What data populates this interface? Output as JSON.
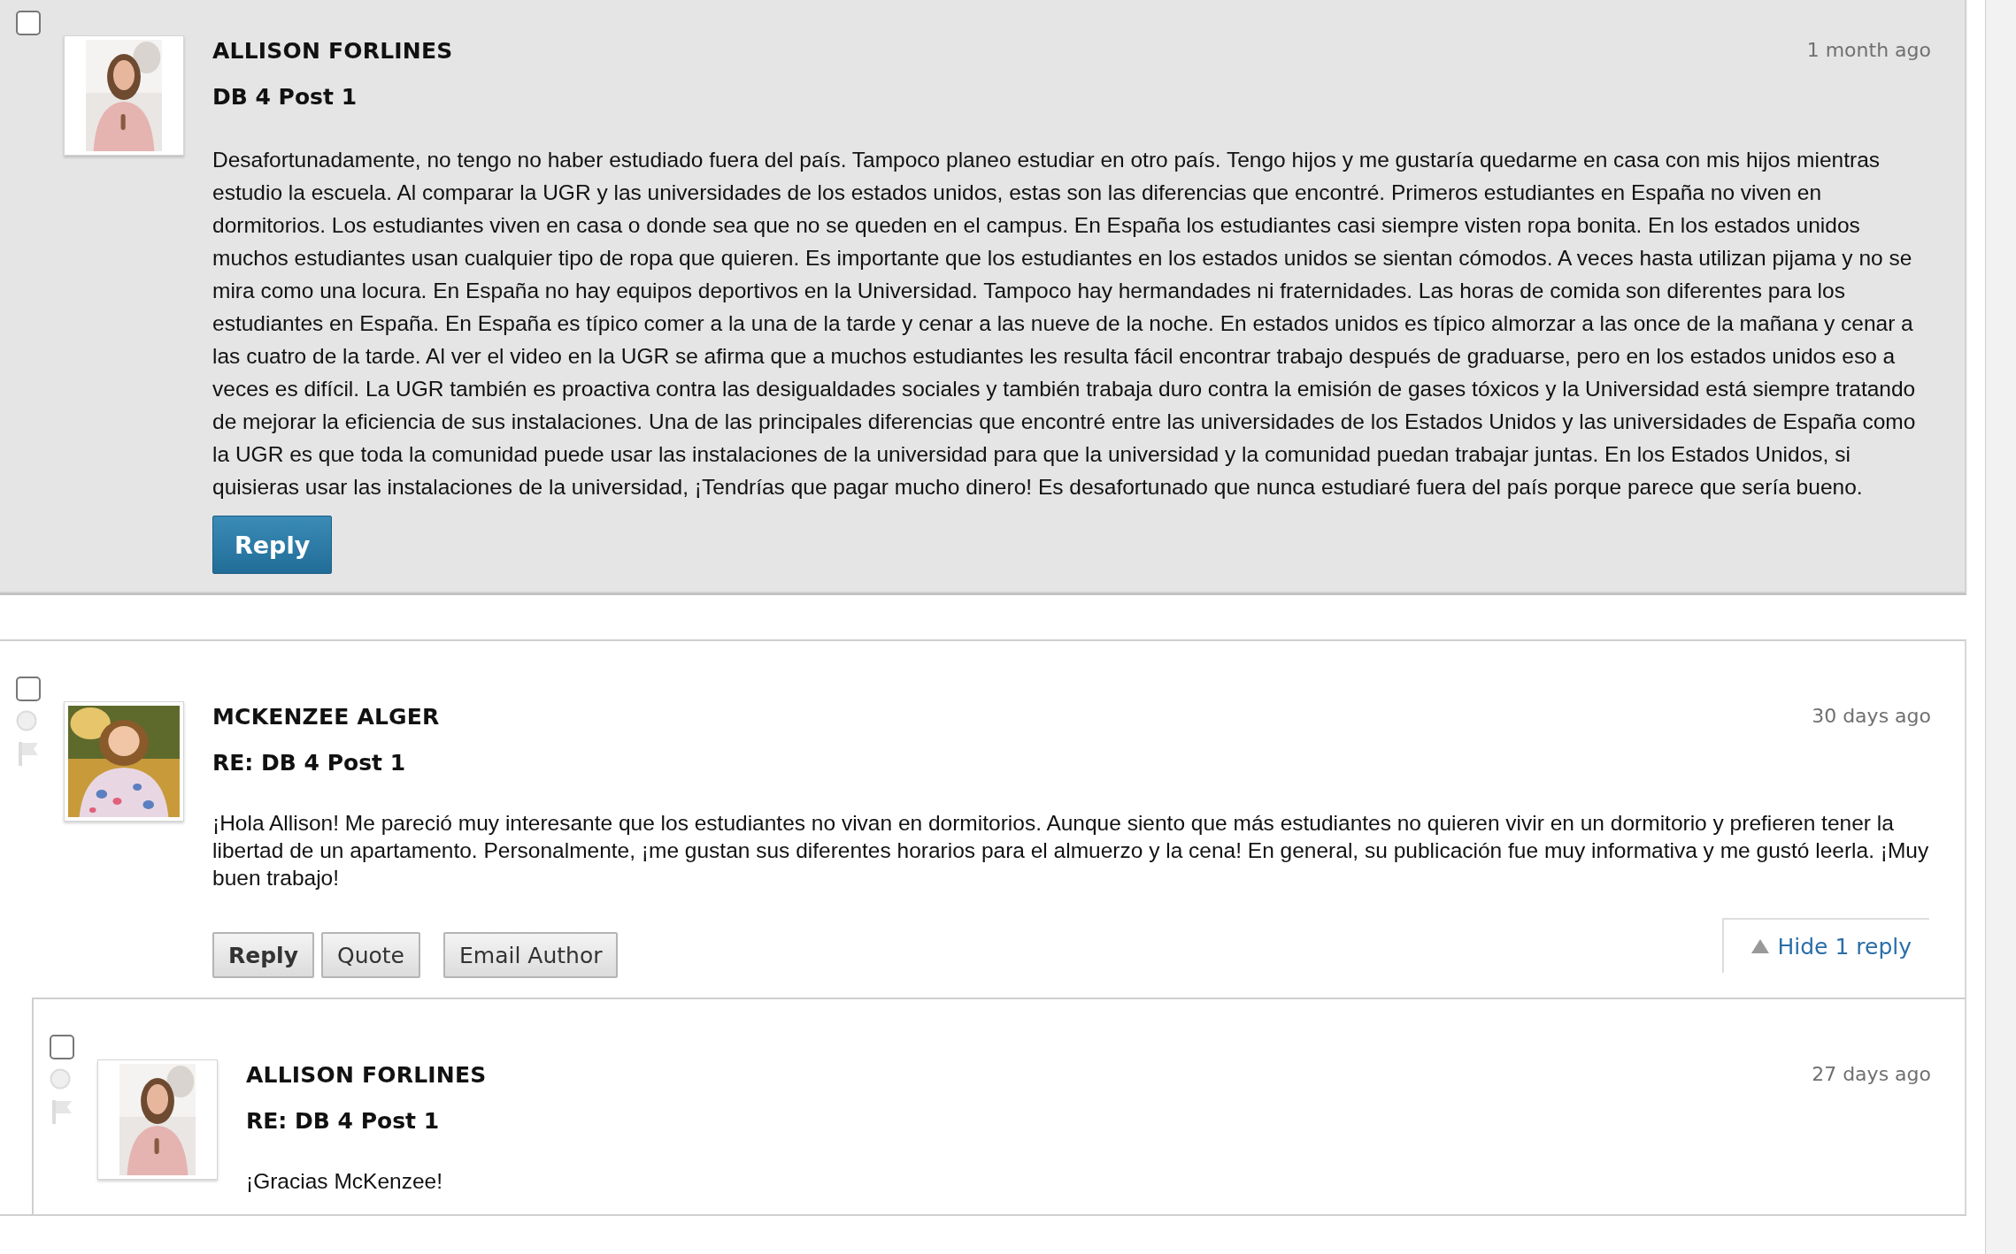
{
  "posts": [
    {
      "author": "ALLISON FORLINES",
      "subject": "DB 4 Post 1",
      "time": "1 month ago",
      "body": "Desafortunadamente, no tengo no haber estudiado fuera del país. Tampoco planeo estudiar en otro país. Tengo hijos y me gustaría quedarme en casa con mis hijos mientras estudio la escuela. Al comparar la UGR y las universidades de los estados unidos, estas son las diferencias que encontré. Primeros estudiantes en España no viven en dormitorios. Los estudiantes viven en casa o donde sea que no se queden en el campus. En España los estudiantes casi siempre visten ropa bonita. En los estados unidos muchos estudiantes usan cualquier tipo de ropa que quieren. Es importante que los estudiantes en los estados unidos se sientan cómodos. A veces hasta utilizan pijama y no se mira como una locura. En España no hay equipos deportivos en la Universidad. Tampoco hay hermandades ni fraternidades. Las horas de comida son diferentes para los estudiantes en España. En España es típico comer a la una de la tarde y cenar a las nueve de la noche. En estados unidos es típico almorzar a las once de la mañana y cenar a las cuatro de la tarde. Al ver el video en la UGR se afirma que a muchos estudiantes les resulta fácil encontrar trabajo después de graduarse, pero en los estados unidos eso a veces es difícil. La UGR también es proactiva contra las desigualdades sociales y también trabaja duro contra la emisión de gases tóxicos y la Universidad está siempre tratando de mejorar la eficiencia de sus instalaciones. Una de las principales diferencias que encontré entre las universidades de los Estados Unidos y las universidades de España como la UGR es que toda la comunidad puede usar las instalaciones de la universidad para que la universidad y la comunidad puedan trabajar juntas. En los Estados Unidos, si quisieras usar las instalaciones de la universidad, ¡Tendrías que pagar mucho dinero! Es desafortunado que nunca estudiaré fuera del país porque parece que sería bueno.",
      "checked": false,
      "selected": true,
      "status_icons": false,
      "buttons": [
        {
          "label": "Reply",
          "kind": "primary"
        }
      ]
    },
    {
      "author": "MCKENZEE ALGER",
      "subject": "RE: DB 4 Post 1",
      "time": "30 days ago",
      "body": "¡Hola Allison! Me pareció muy interesante que los estudiantes no vivan en dormitorios. Aunque siento que más estudiantes no quieren vivir en un dormitorio y prefieren tener la libertad de un apartamento. Personalmente, ¡me gustan sus diferentes horarios para el almuerzo y la cena! En general, su publicación fue muy informativa y me gustó leerla. ¡Muy buen trabajo!",
      "checked": false,
      "selected": false,
      "status_icons": true,
      "buttons": [
        {
          "label": "Reply",
          "kind": "strong"
        },
        {
          "label": "Quote",
          "kind": "plain"
        },
        {
          "label": "Email Author",
          "kind": "spaced"
        }
      ],
      "replies_toggle": {
        "label": "Hide 1 reply",
        "expanded": true
      },
      "children": [
        {
          "author": "ALLISON FORLINES",
          "subject": "RE: DB 4 Post 1",
          "time": "27 days ago",
          "body": "¡Gracias McKenzee!",
          "checked": false,
          "selected": false,
          "status_icons": true
        }
      ]
    }
  ]
}
